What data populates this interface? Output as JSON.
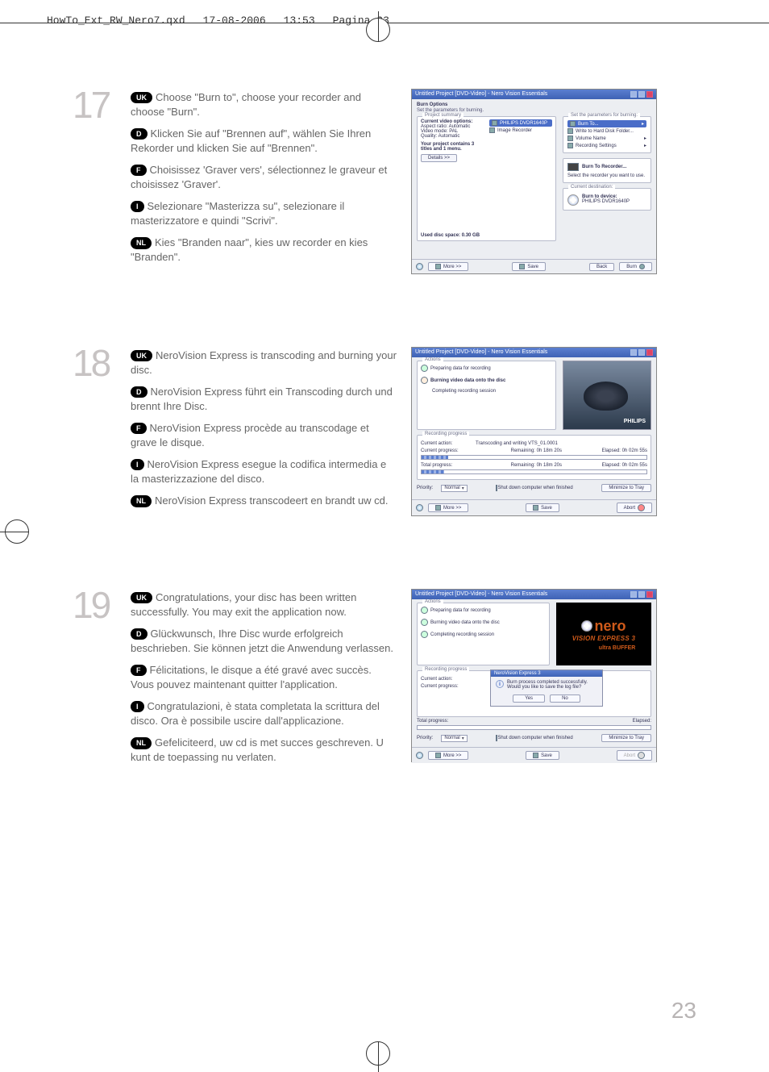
{
  "header": {
    "file": "HowTo_Ext_RW_Nero7.qxd",
    "date": "17-08-2006",
    "time": "13:53",
    "page": "Pagina 23"
  },
  "page_number": "23",
  "langs": {
    "uk": "UK",
    "d": "D",
    "f": "F",
    "i": "I",
    "nl": "NL"
  },
  "steps": [
    {
      "num": "17",
      "paras": {
        "uk": "Choose \"Burn to\", choose your recorder and choose \"Burn\".",
        "d": "Klicken Sie auf \"Brennen auf\", wählen Sie Ihren Rekorder und klicken Sie auf \"Brennen\".",
        "f": "Choisissez 'Graver vers', sélectionnez le graveur et choisissez 'Graver'.",
        "i": "Selezionare \"Masterizza su\", selezionare il masterizzatore e quindi \"Scrivi\".",
        "nl": "Kies \"Branden naar\", kies uw recorder en kies \"Branden\"."
      },
      "shot": {
        "title": "Untitled Project [DVD-Video] - Nero Vision Essentials",
        "heading": "Burn Options",
        "sub": "Set the parameters for burning.",
        "panel_legend": "Project summary",
        "left": {
          "cur_opts_label": "Current video options:",
          "aspect": "Aspect ratio: Automatic",
          "mode": "Video mode: PAL",
          "quality": "Quality: Automatic",
          "contains": "Your project contains 3 titles and 1 menu.",
          "details": "Details >>"
        },
        "used": "Used disc space: 0.30 GB",
        "recorders": {
          "opt1": "PHILIPS  DVDR1640P",
          "opt2": "Image Recorder"
        },
        "right_legend": "Set the parameters for burning:",
        "right": {
          "burn_to": "Burn To...",
          "write_hd": "Write to Hard Disk Folder...",
          "vol_name": "Volume Name",
          "rec_set": "Recording Settings",
          "burn_to_rec": "Burn To Recorder...",
          "select_rec": "Select the recorder you want to use.",
          "cur_dest": "Current destination:",
          "dev_label": "Burn to device:",
          "device": "PHILIPS DVDR1640P"
        },
        "footer": {
          "more": "More >>",
          "save": "Save",
          "back": "Back",
          "burn": "Burn"
        }
      }
    },
    {
      "num": "18",
      "paras": {
        "uk": "NeroVision Express is transcoding and burning your disc.",
        "d": "NeroVision Express führt ein Transcoding durch und brennt Ihre Disc.",
        "f": "NeroVision Express procède au transcodage et grave le disque.",
        "i": "NeroVision Express esegue la codifica intermedia e la masterizzazione del disco.",
        "nl": "NeroVision Express transcodeert en brandt uw cd."
      },
      "shot": {
        "title": "Untitled Project [DVD-Video] - Nero Vision Essentials",
        "actions_legend": "Actions",
        "actions": {
          "a1": "Preparing data for recording",
          "a2": "Burning video data onto the disc",
          "a3": "Completing recording session"
        },
        "preview_brand": "PHILIPS",
        "rec_legend": "Recording progress",
        "cur_action_lbl": "Current action:",
        "cur_action_val": "Transcoding and writing VTS_01.0001",
        "cur_prog_lbl": "Current progress:",
        "remaining_lbl": "Remaining:",
        "remaining_val": "0h 18m 20s",
        "elapsed_lbl": "Elapsed:",
        "elapsed_val": "0h 02m 55s",
        "total_lbl": "Total progress:",
        "total_rem": "0h 18m 20s",
        "total_el": "0h 02m 55s",
        "priority_lbl": "Priority:",
        "priority_val": "Normal",
        "shutdown": "Shut down computer when finished",
        "min_tray": "Minimize to Tray",
        "footer": {
          "more": "More >>",
          "save": "Save",
          "abort": "Abort"
        }
      }
    },
    {
      "num": "19",
      "paras": {
        "uk": "Congratulations, your disc has been written successfully. You may exit the application now.",
        "d": "Glückwunsch, Ihre Disc wurde erfolgreich beschrieben. Sie können jetzt die Anwendung verlassen.",
        "f": "Félicitations, le disque a été gravé avec succès. Vous pouvez maintenant quitter l'application.",
        "i": "Congratulazioni, è stata completata la scrittura del disco. Ora è possibile uscire dall'applicazione.",
        "nl": "Gefeliciteerd, uw cd is met succes geschreven. U kunt de toepassing nu verlaten."
      },
      "shot": {
        "title": "Untitled Project [DVD-Video] - Nero Vision Essentials",
        "actions_legend": "Actions",
        "actions": {
          "a1": "Preparing data for recording",
          "a2": "Burning video data onto the disc",
          "a3": "Completing recording session"
        },
        "logo_nero": "nero",
        "logo_vision": "VISION EXPRESS 3",
        "logo_ultra": "ultra BUFFER",
        "dialog_title": "NeroVision Express 3",
        "dialog_msg1": "Burn process completed successfully.",
        "dialog_msg2": "Would you like to save the log file?",
        "dialog_yes": "Yes",
        "dialog_no": "No",
        "rec_legend": "Recording progress",
        "cur_action_lbl": "Current action:",
        "cur_prog_lbl": "Current progress:",
        "total_lbl": "Total progress:",
        "elapsed_lbl": "Elapsed:",
        "priority_lbl": "Priority:",
        "priority_val": "Normal",
        "shutdown": "Shut down computer when finished",
        "min_tray": "Minimize to Tray",
        "footer": {
          "more": "More >>",
          "save": "Save",
          "abort": "Abort"
        }
      }
    }
  ]
}
